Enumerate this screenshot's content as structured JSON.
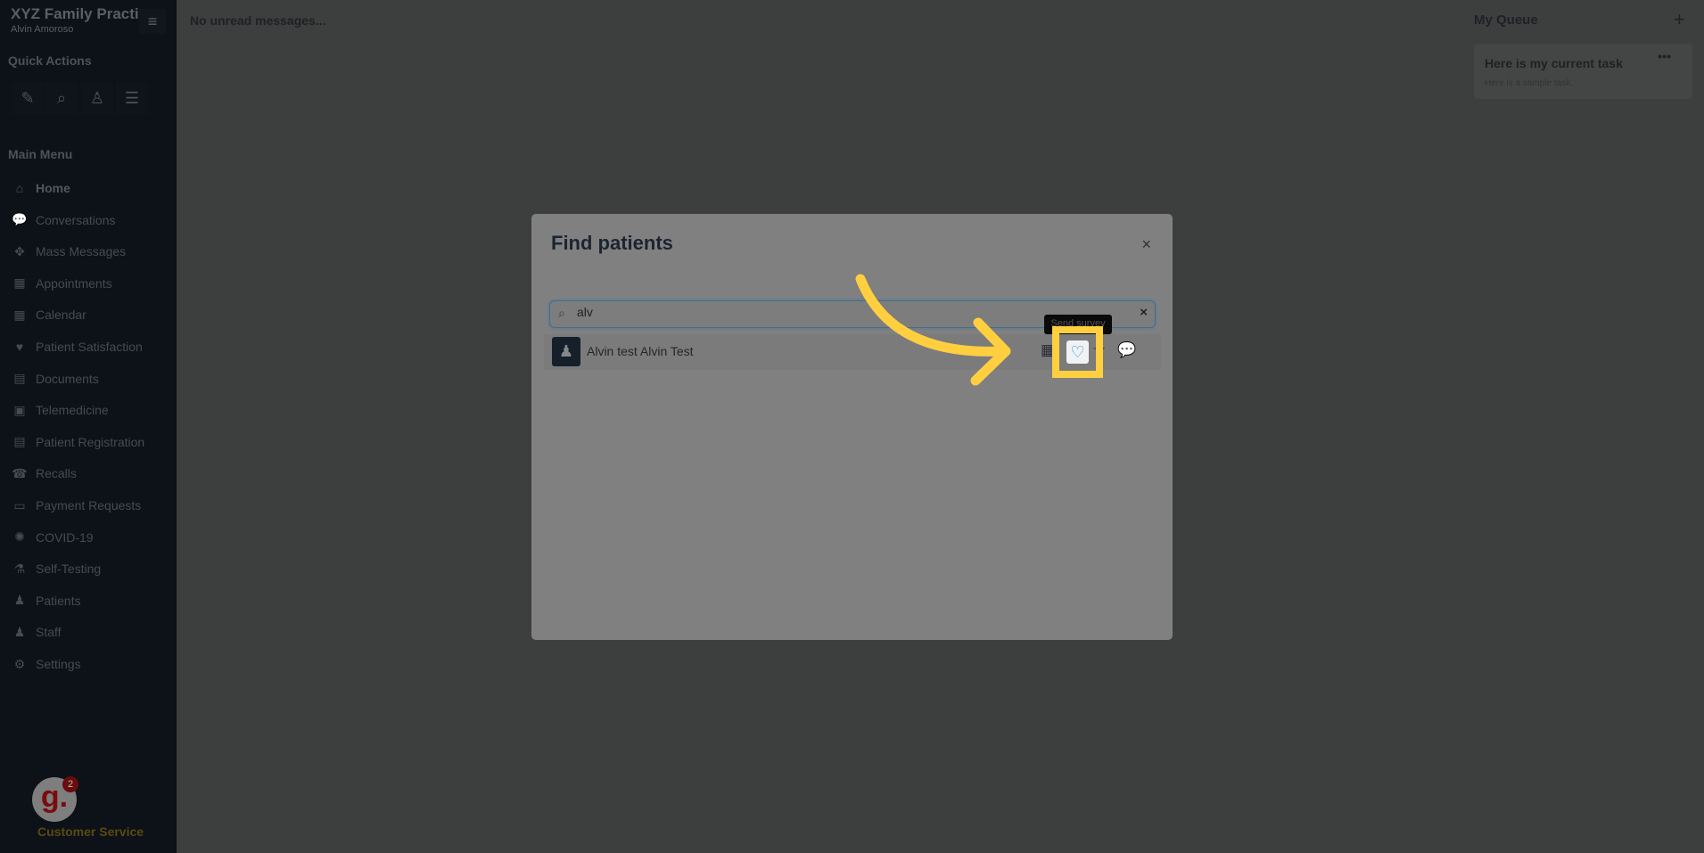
{
  "sidebar": {
    "brand": "XYZ Family Practice",
    "user": "Alvin Amoroso",
    "quick_actions_title": "Quick Actions",
    "main_menu_title": "Main Menu",
    "quick_actions": [
      {
        "icon": "compose-icon",
        "glyph": "✎"
      },
      {
        "icon": "search-icon",
        "glyph": "⌕"
      },
      {
        "icon": "patient-icon",
        "glyph": "♙"
      },
      {
        "icon": "sliders-icon",
        "glyph": "☰"
      }
    ],
    "items": [
      {
        "label": "Home",
        "icon": "home-icon",
        "glyph": "⌂"
      },
      {
        "label": "Conversations",
        "icon": "chat-icon",
        "glyph": "💬"
      },
      {
        "label": "Mass Messages",
        "icon": "broadcast-icon",
        "glyph": "✥"
      },
      {
        "label": "Appointments",
        "icon": "appointments-icon",
        "glyph": "▦"
      },
      {
        "label": "Calendar",
        "icon": "calendar-icon",
        "glyph": "▦"
      },
      {
        "label": "Patient Satisfaction",
        "icon": "heart-icon",
        "glyph": "♥"
      },
      {
        "label": "Documents",
        "icon": "documents-icon",
        "glyph": "▤"
      },
      {
        "label": "Telemedicine",
        "icon": "telemedicine-icon",
        "glyph": "▣"
      },
      {
        "label": "Patient Registration",
        "icon": "registration-icon",
        "glyph": "▤"
      },
      {
        "label": "Recalls",
        "icon": "phone-icon",
        "glyph": "☎"
      },
      {
        "label": "Payment Requests",
        "icon": "card-icon",
        "glyph": "▭"
      },
      {
        "label": "COVID-19",
        "icon": "virus-icon",
        "glyph": "✺"
      },
      {
        "label": "Self-Testing",
        "icon": "flask-icon",
        "glyph": "⚗"
      },
      {
        "label": "Patients",
        "icon": "user-icon",
        "glyph": "♟"
      },
      {
        "label": "Staff",
        "icon": "staff-icon",
        "glyph": "♟"
      },
      {
        "label": "Settings",
        "icon": "gear-icon",
        "glyph": "⚙"
      }
    ],
    "logo_letter": "g.",
    "notification_count": "2",
    "customer_service": "Customer Service"
  },
  "main": {
    "unread": "No unread messages..."
  },
  "queue": {
    "title": "My Queue",
    "add": "+",
    "task_title": "Here is my current task",
    "task_desc": "Here is a sample task.",
    "task_menu": "•••"
  },
  "modal": {
    "title": "Find patients",
    "close": "×",
    "search_value": "alv",
    "clear": "×",
    "results": [
      {
        "name": "Alvin test Alvin Test"
      }
    ],
    "tooltip": "Send survey",
    "actions": [
      {
        "icon": "calendar-icon",
        "glyph": "▦"
      },
      {
        "icon": "heart-icon",
        "glyph": "♡"
      },
      {
        "icon": "star-icon",
        "glyph": "☆"
      },
      {
        "icon": "chat-icon",
        "glyph": "💬"
      }
    ]
  },
  "colors": {
    "highlight": "#ffcf3f",
    "heart": "#3d9be0"
  }
}
